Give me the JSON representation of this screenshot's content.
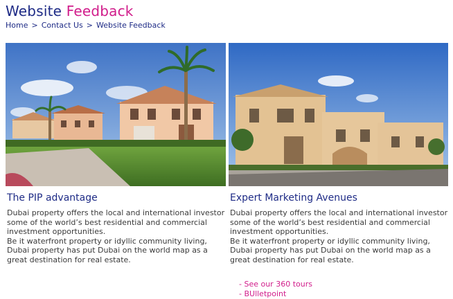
{
  "header": {
    "title_part1": "Website",
    "title_part2": "Feedback"
  },
  "breadcrumb": {
    "items": [
      "Home",
      "Contact Us",
      "Website Feedback"
    ],
    "separator": ">"
  },
  "columns": [
    {
      "heading": "The PIP advantage",
      "paragraph1": "Dubai property offers the local and international investor some of the world’s best residential and commercial investment opportunities.",
      "paragraph2": "Be it waterfront property or idyllic community living, Dubai property has put Dubai on the world map as a great destination for real estate."
    },
    {
      "heading": "Expert Marketing Avenues",
      "paragraph1": "Dubai property offers the local and international investor some of the world’s best residential and commercial investment opportunities.",
      "paragraph2": "Be it waterfront property or idyllic community living, Dubai property has put Dubai on the world map as a great destination for real estate."
    }
  ],
  "links": [
    "- See our 360 tours",
    "- BUlletpoint"
  ],
  "colors": {
    "brand_navy": "#1e2b86",
    "accent_magenta": "#d11d8b"
  }
}
